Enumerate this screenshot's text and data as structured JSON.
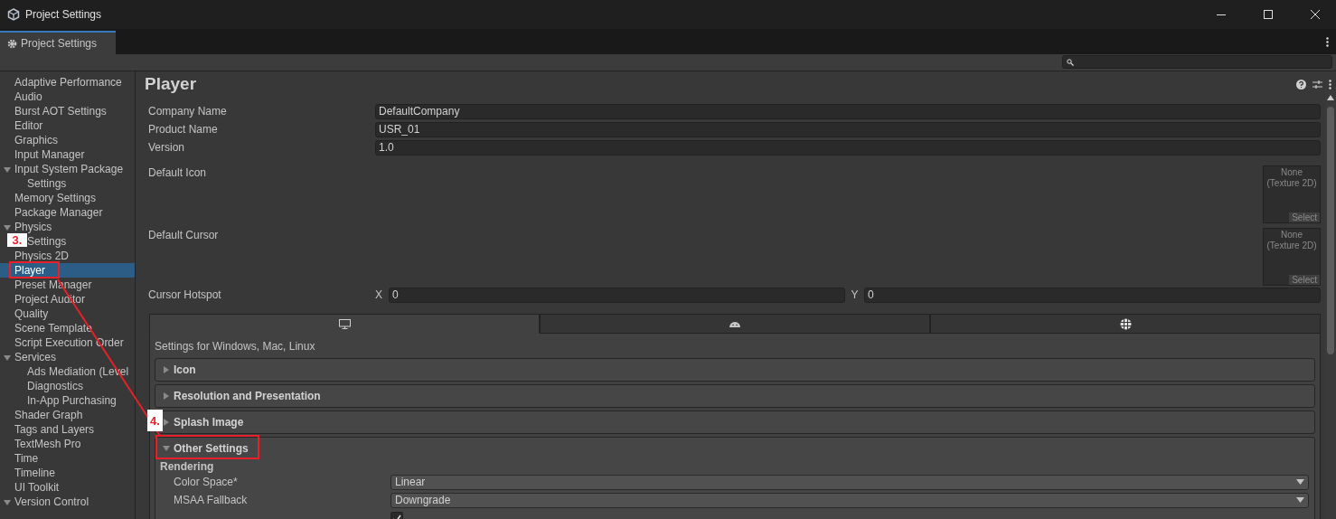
{
  "window": {
    "title": "Project Settings"
  },
  "tabs": [
    {
      "label": "Project Settings",
      "selected": true
    }
  ],
  "sidebar": {
    "items": [
      {
        "label": "Adaptive Performance",
        "selected": false
      },
      {
        "label": "Audio",
        "selected": false
      },
      {
        "label": "Burst AOT Settings",
        "selected": false
      },
      {
        "label": "Editor",
        "selected": false
      },
      {
        "label": "Graphics",
        "selected": false
      },
      {
        "label": "Input Manager",
        "selected": false
      },
      {
        "label": "Input System Package",
        "selected": false,
        "expanded": true,
        "children": [
          {
            "label": "Settings",
            "selected": false
          }
        ]
      },
      {
        "label": "Memory Settings",
        "selected": false
      },
      {
        "label": "Package Manager",
        "selected": false
      },
      {
        "label": "Physics",
        "selected": false,
        "expanded": true,
        "children": [
          {
            "label": "Settings",
            "selected": false
          }
        ]
      },
      {
        "label": "Physics 2D",
        "selected": false
      },
      {
        "label": "Player",
        "selected": true
      },
      {
        "label": "Preset Manager",
        "selected": false
      },
      {
        "label": "Project Auditor",
        "selected": false
      },
      {
        "label": "Quality",
        "selected": false
      },
      {
        "label": "Scene Template",
        "selected": false
      },
      {
        "label": "Script Execution Order",
        "selected": false
      },
      {
        "label": "Services",
        "selected": false,
        "expanded": true,
        "children": [
          {
            "label": "Ads Mediation (Level",
            "selected": false
          },
          {
            "label": "Diagnostics",
            "selected": false
          },
          {
            "label": "In-App Purchasing",
            "selected": false
          }
        ]
      },
      {
        "label": "Shader Graph",
        "selected": false
      },
      {
        "label": "Tags and Layers",
        "selected": false
      },
      {
        "label": "TextMesh Pro",
        "selected": false
      },
      {
        "label": "Time",
        "selected": false
      },
      {
        "label": "Timeline",
        "selected": false
      },
      {
        "label": "UI Toolkit",
        "selected": false
      },
      {
        "label": "Version Control",
        "selected": false,
        "expanded": true
      }
    ]
  },
  "inspector": {
    "title": "Player",
    "fields": [
      {
        "label": "Company Name",
        "value": "DefaultCompany"
      },
      {
        "label": "Product Name",
        "value": "USR_01"
      },
      {
        "label": "Version",
        "value": "1.0"
      }
    ],
    "textures": [
      {
        "label": "Default Icon",
        "text": "None (Texture 2D)",
        "button": "Select"
      },
      {
        "label": "Default Cursor",
        "text": "None (Texture 2D)",
        "button": "Select"
      }
    ],
    "hotspot": {
      "label": "Cursor Hotspot",
      "x_label": "X",
      "x_value": "0",
      "y_label": "Y",
      "y_value": "0"
    },
    "platform_tabs": [
      {
        "kind": "desktop",
        "selected": true
      },
      {
        "kind": "android",
        "selected": false
      },
      {
        "kind": "web",
        "selected": false
      }
    ],
    "platform_caption": "Settings for Windows, Mac, Linux",
    "sections": [
      {
        "label": "Icon",
        "expanded": false
      },
      {
        "label": "Resolution and Presentation",
        "expanded": false
      },
      {
        "label": "Splash Image",
        "expanded": false
      },
      {
        "label": "Other Settings",
        "expanded": true,
        "group": "Rendering",
        "rows": [
          {
            "kind": "dropdown",
            "label": "Color Space*",
            "value": "Linear"
          },
          {
            "kind": "dropdown",
            "label": "MSAA Fallback",
            "value": "Downgrade"
          },
          {
            "kind": "checkbox",
            "checked": true
          }
        ]
      }
    ]
  },
  "annotations": [
    {
      "label": "3."
    },
    {
      "label": "4."
    }
  ]
}
